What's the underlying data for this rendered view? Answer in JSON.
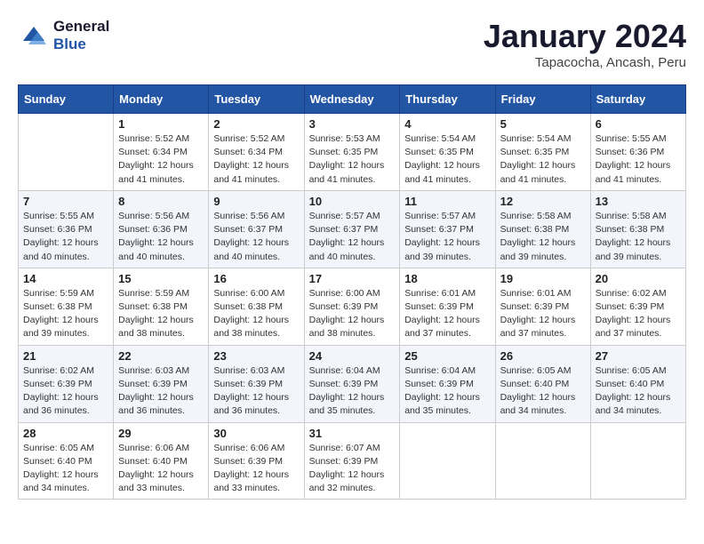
{
  "header": {
    "logo_line1": "General",
    "logo_line2": "Blue",
    "title": "January 2024",
    "subtitle": "Tapacocha, Ancash, Peru"
  },
  "days_of_week": [
    "Sunday",
    "Monday",
    "Tuesday",
    "Wednesday",
    "Thursday",
    "Friday",
    "Saturday"
  ],
  "weeks": [
    [
      {
        "day": "",
        "sunrise": "",
        "sunset": "",
        "daylight": ""
      },
      {
        "day": "1",
        "sunrise": "Sunrise: 5:52 AM",
        "sunset": "Sunset: 6:34 PM",
        "daylight": "Daylight: 12 hours and 41 minutes."
      },
      {
        "day": "2",
        "sunrise": "Sunrise: 5:52 AM",
        "sunset": "Sunset: 6:34 PM",
        "daylight": "Daylight: 12 hours and 41 minutes."
      },
      {
        "day": "3",
        "sunrise": "Sunrise: 5:53 AM",
        "sunset": "Sunset: 6:35 PM",
        "daylight": "Daylight: 12 hours and 41 minutes."
      },
      {
        "day": "4",
        "sunrise": "Sunrise: 5:54 AM",
        "sunset": "Sunset: 6:35 PM",
        "daylight": "Daylight: 12 hours and 41 minutes."
      },
      {
        "day": "5",
        "sunrise": "Sunrise: 5:54 AM",
        "sunset": "Sunset: 6:35 PM",
        "daylight": "Daylight: 12 hours and 41 minutes."
      },
      {
        "day": "6",
        "sunrise": "Sunrise: 5:55 AM",
        "sunset": "Sunset: 6:36 PM",
        "daylight": "Daylight: 12 hours and 41 minutes."
      }
    ],
    [
      {
        "day": "7",
        "sunrise": "Sunrise: 5:55 AM",
        "sunset": "Sunset: 6:36 PM",
        "daylight": "Daylight: 12 hours and 40 minutes."
      },
      {
        "day": "8",
        "sunrise": "Sunrise: 5:56 AM",
        "sunset": "Sunset: 6:36 PM",
        "daylight": "Daylight: 12 hours and 40 minutes."
      },
      {
        "day": "9",
        "sunrise": "Sunrise: 5:56 AM",
        "sunset": "Sunset: 6:37 PM",
        "daylight": "Daylight: 12 hours and 40 minutes."
      },
      {
        "day": "10",
        "sunrise": "Sunrise: 5:57 AM",
        "sunset": "Sunset: 6:37 PM",
        "daylight": "Daylight: 12 hours and 40 minutes."
      },
      {
        "day": "11",
        "sunrise": "Sunrise: 5:57 AM",
        "sunset": "Sunset: 6:37 PM",
        "daylight": "Daylight: 12 hours and 39 minutes."
      },
      {
        "day": "12",
        "sunrise": "Sunrise: 5:58 AM",
        "sunset": "Sunset: 6:38 PM",
        "daylight": "Daylight: 12 hours and 39 minutes."
      },
      {
        "day": "13",
        "sunrise": "Sunrise: 5:58 AM",
        "sunset": "Sunset: 6:38 PM",
        "daylight": "Daylight: 12 hours and 39 minutes."
      }
    ],
    [
      {
        "day": "14",
        "sunrise": "Sunrise: 5:59 AM",
        "sunset": "Sunset: 6:38 PM",
        "daylight": "Daylight: 12 hours and 39 minutes."
      },
      {
        "day": "15",
        "sunrise": "Sunrise: 5:59 AM",
        "sunset": "Sunset: 6:38 PM",
        "daylight": "Daylight: 12 hours and 38 minutes."
      },
      {
        "day": "16",
        "sunrise": "Sunrise: 6:00 AM",
        "sunset": "Sunset: 6:38 PM",
        "daylight": "Daylight: 12 hours and 38 minutes."
      },
      {
        "day": "17",
        "sunrise": "Sunrise: 6:00 AM",
        "sunset": "Sunset: 6:39 PM",
        "daylight": "Daylight: 12 hours and 38 minutes."
      },
      {
        "day": "18",
        "sunrise": "Sunrise: 6:01 AM",
        "sunset": "Sunset: 6:39 PM",
        "daylight": "Daylight: 12 hours and 37 minutes."
      },
      {
        "day": "19",
        "sunrise": "Sunrise: 6:01 AM",
        "sunset": "Sunset: 6:39 PM",
        "daylight": "Daylight: 12 hours and 37 minutes."
      },
      {
        "day": "20",
        "sunrise": "Sunrise: 6:02 AM",
        "sunset": "Sunset: 6:39 PM",
        "daylight": "Daylight: 12 hours and 37 minutes."
      }
    ],
    [
      {
        "day": "21",
        "sunrise": "Sunrise: 6:02 AM",
        "sunset": "Sunset: 6:39 PM",
        "daylight": "Daylight: 12 hours and 36 minutes."
      },
      {
        "day": "22",
        "sunrise": "Sunrise: 6:03 AM",
        "sunset": "Sunset: 6:39 PM",
        "daylight": "Daylight: 12 hours and 36 minutes."
      },
      {
        "day": "23",
        "sunrise": "Sunrise: 6:03 AM",
        "sunset": "Sunset: 6:39 PM",
        "daylight": "Daylight: 12 hours and 36 minutes."
      },
      {
        "day": "24",
        "sunrise": "Sunrise: 6:04 AM",
        "sunset": "Sunset: 6:39 PM",
        "daylight": "Daylight: 12 hours and 35 minutes."
      },
      {
        "day": "25",
        "sunrise": "Sunrise: 6:04 AM",
        "sunset": "Sunset: 6:39 PM",
        "daylight": "Daylight: 12 hours and 35 minutes."
      },
      {
        "day": "26",
        "sunrise": "Sunrise: 6:05 AM",
        "sunset": "Sunset: 6:40 PM",
        "daylight": "Daylight: 12 hours and 34 minutes."
      },
      {
        "day": "27",
        "sunrise": "Sunrise: 6:05 AM",
        "sunset": "Sunset: 6:40 PM",
        "daylight": "Daylight: 12 hours and 34 minutes."
      }
    ],
    [
      {
        "day": "28",
        "sunrise": "Sunrise: 6:05 AM",
        "sunset": "Sunset: 6:40 PM",
        "daylight": "Daylight: 12 hours and 34 minutes."
      },
      {
        "day": "29",
        "sunrise": "Sunrise: 6:06 AM",
        "sunset": "Sunset: 6:40 PM",
        "daylight": "Daylight: 12 hours and 33 minutes."
      },
      {
        "day": "30",
        "sunrise": "Sunrise: 6:06 AM",
        "sunset": "Sunset: 6:39 PM",
        "daylight": "Daylight: 12 hours and 33 minutes."
      },
      {
        "day": "31",
        "sunrise": "Sunrise: 6:07 AM",
        "sunset": "Sunset: 6:39 PM",
        "daylight": "Daylight: 12 hours and 32 minutes."
      },
      {
        "day": "",
        "sunrise": "",
        "sunset": "",
        "daylight": ""
      },
      {
        "day": "",
        "sunrise": "",
        "sunset": "",
        "daylight": ""
      },
      {
        "day": "",
        "sunrise": "",
        "sunset": "",
        "daylight": ""
      }
    ]
  ]
}
